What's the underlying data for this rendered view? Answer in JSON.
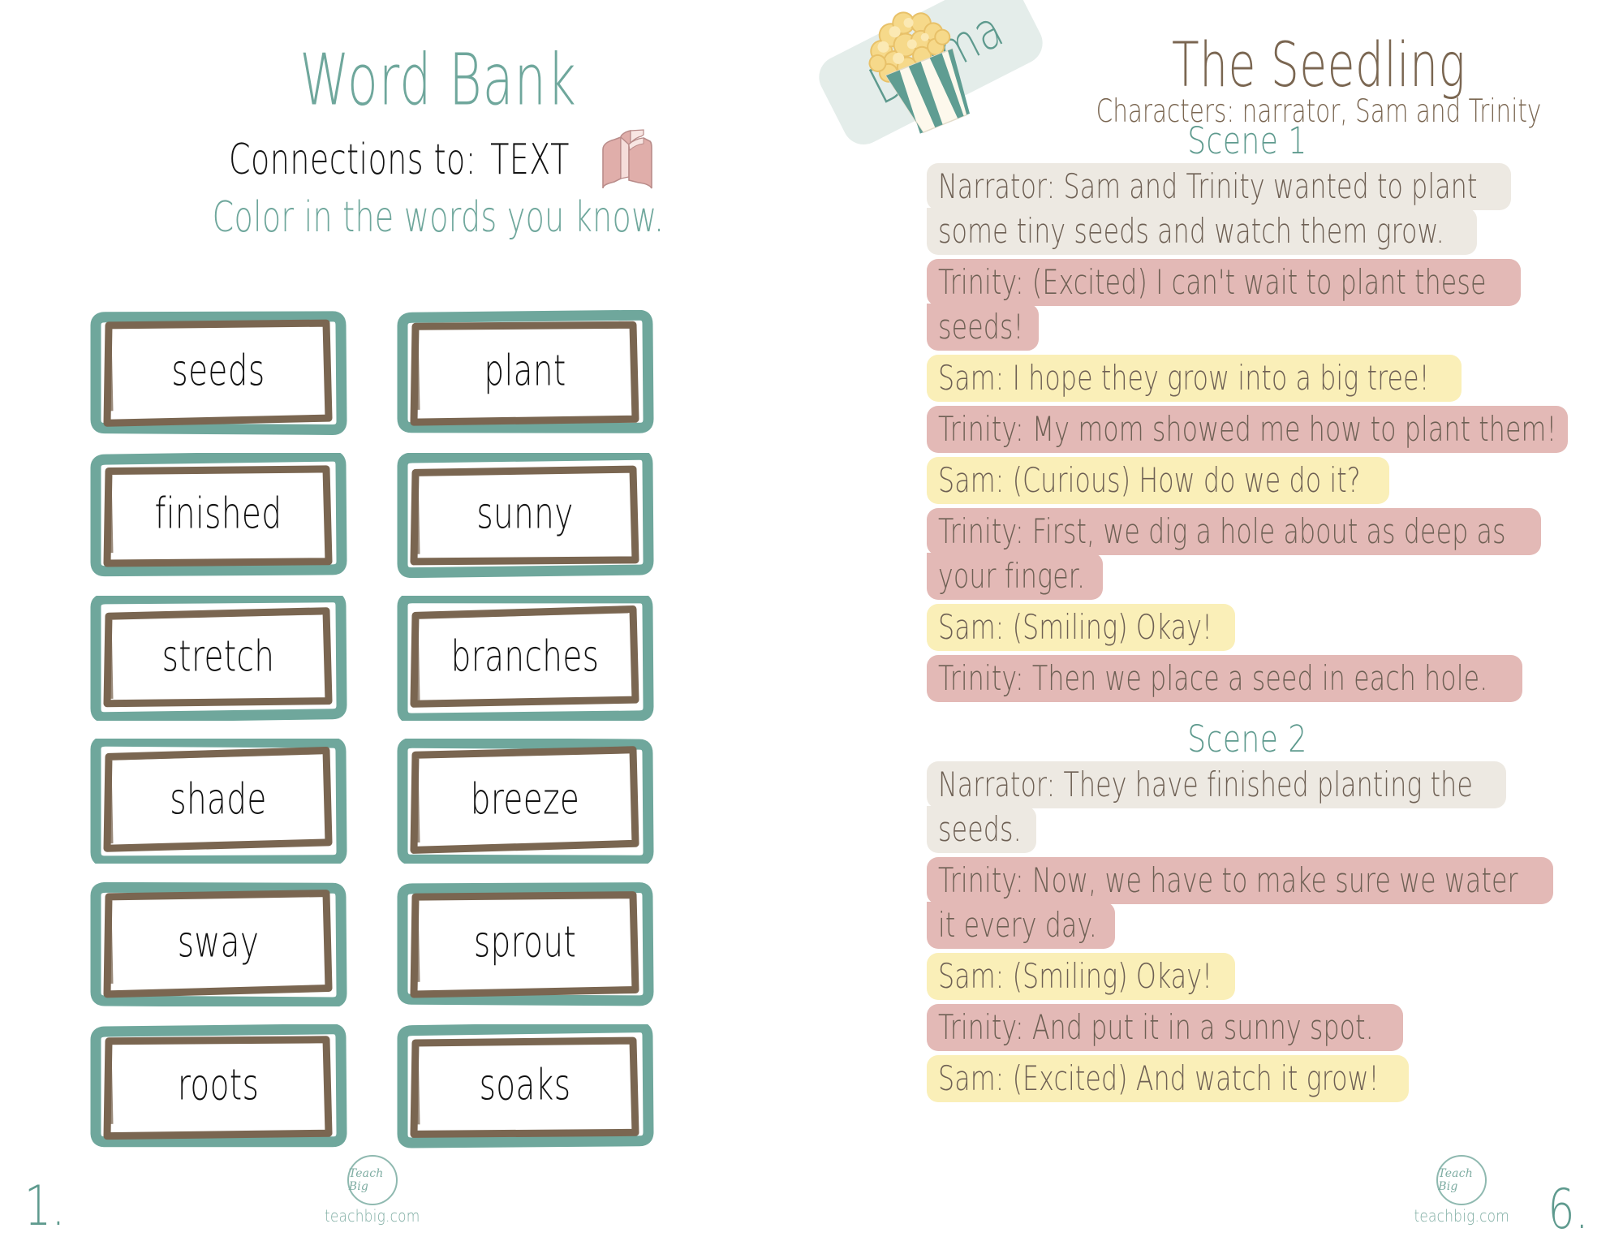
{
  "colors": {
    "teal": "#6FA79C",
    "teal_dark": "#5E9A8E",
    "brown": "#7A6651",
    "narrator_highlight": "#EDE9E2",
    "trinity_highlight": "#E3B9B6",
    "sam_highlight": "#FAEFB8",
    "dialogue_text": "#6E6054",
    "banner_bg": "#E4EDEA",
    "book_pink": "#E0AEAA"
  },
  "left_page": {
    "title": "Word Bank",
    "subtitle_prefix": "Connections to:",
    "subtitle_emphasis": "TEXT",
    "book_icon": "open-book-icon",
    "instruction": "Color in the words you know.",
    "words": [
      "seeds",
      "plant",
      "finished",
      "sunny",
      "stretch",
      "branches",
      "shade",
      "breeze",
      "sway",
      "sprout",
      "roots",
      "soaks"
    ],
    "page_number": "1."
  },
  "right_page": {
    "banner_label": "Drama",
    "banner_icon": "popcorn-icon",
    "title": "The Seedling",
    "characters": "Characters: narrator, Sam and Trinity",
    "scenes": [
      {
        "heading": "Scene 1",
        "lines": [
          {
            "speaker": "narrator",
            "text_lines": [
              "Narrator: Sam and Trinity wanted to plant",
              "some tiny seeds and watch them grow."
            ]
          },
          {
            "speaker": "trinity",
            "text_lines": [
              "Trinity: (Excited) I can't wait to plant these",
              "seeds!"
            ]
          },
          {
            "speaker": "sam",
            "text_lines": [
              "Sam: I hope they grow into a big tree!"
            ]
          },
          {
            "speaker": "trinity",
            "text_lines": [
              "Trinity: My mom showed me how to plant them!"
            ]
          },
          {
            "speaker": "sam",
            "text_lines": [
              "Sam: (Curious) How do we do it?"
            ]
          },
          {
            "speaker": "trinity",
            "text_lines": [
              "Trinity: First, we dig a hole about as deep as",
              "your finger."
            ]
          },
          {
            "speaker": "sam",
            "text_lines": [
              "Sam: (Smiling) Okay!"
            ]
          },
          {
            "speaker": "trinity",
            "text_lines": [
              "Trinity: Then we place a seed in each hole."
            ]
          }
        ]
      },
      {
        "heading": "Scene 2",
        "lines": [
          {
            "speaker": "narrator",
            "text_lines": [
              "Narrator: They have finished planting the",
              "seeds."
            ]
          },
          {
            "speaker": "trinity",
            "text_lines": [
              "Trinity: Now, we have to make sure we water",
              "it every day."
            ]
          },
          {
            "speaker": "sam",
            "text_lines": [
              "Sam: (Smiling) Okay!"
            ]
          },
          {
            "speaker": "trinity",
            "text_lines": [
              "Trinity: And put it in a sunny spot."
            ]
          },
          {
            "speaker": "sam",
            "text_lines": [
              "Sam: (Excited) And watch it grow!"
            ]
          }
        ]
      }
    ],
    "page_number": "6."
  },
  "footer": {
    "logo_text": "Teach Big",
    "logo_url": "teachbig.com"
  }
}
